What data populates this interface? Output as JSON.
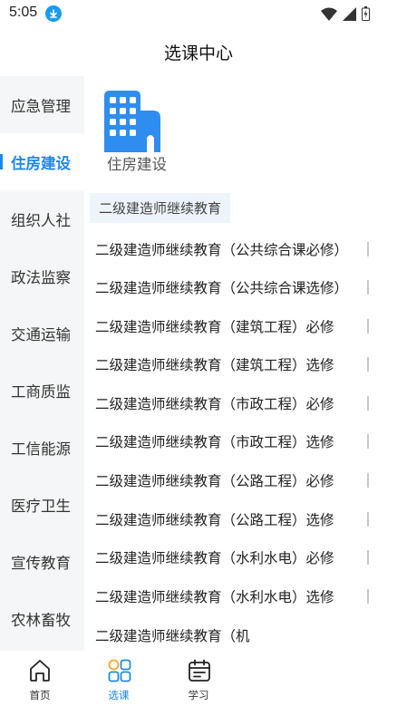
{
  "status_bar": {
    "time": "5:05"
  },
  "header": {
    "title": "选课中心"
  },
  "sidebar": {
    "items": [
      {
        "label": "应急管理",
        "active": false
      },
      {
        "label": "住房建设",
        "active": true
      },
      {
        "label": "组织人社",
        "active": false
      },
      {
        "label": "政法监察",
        "active": false
      },
      {
        "label": "交通运输",
        "active": false
      },
      {
        "label": "工商质监",
        "active": false
      },
      {
        "label": "工信能源",
        "active": false
      },
      {
        "label": "医疗卫生",
        "active": false
      },
      {
        "label": "宣传教育",
        "active": false
      },
      {
        "label": "农林畜牧",
        "active": false
      }
    ]
  },
  "category": {
    "label": "住房建设",
    "icon": "building-icon"
  },
  "sub_tab": {
    "label": "二级建造师继续教育"
  },
  "courses": [
    "二级建造师继续教育（公共综合课必修）",
    "二级建造师继续教育（公共综合课选修）",
    "二级建造师继续教育（建筑工程）必修",
    "二级建造师继续教育（建筑工程）选修",
    "二级建造师继续教育（市政工程）必修",
    "二级建造师继续教育（市政工程）选修",
    "二级建造师继续教育（公路工程）必修",
    "二级建造师继续教育（公路工程）选修",
    "二级建造师继续教育（水利水电）必修",
    "二级建造师继续教育（水利水电）选修",
    "二级建造师继续教育（机"
  ],
  "bottom_nav": [
    {
      "label": "首页",
      "icon": "home-icon",
      "active": false
    },
    {
      "label": "选课",
      "icon": "grid-icon",
      "active": true
    },
    {
      "label": "学习",
      "icon": "calendar-icon",
      "active": false
    }
  ],
  "colors": {
    "accent": "#1e88e5",
    "sidebar_bg": "#f5f6f7",
    "sub_tab_bg": "#eef4fb"
  }
}
